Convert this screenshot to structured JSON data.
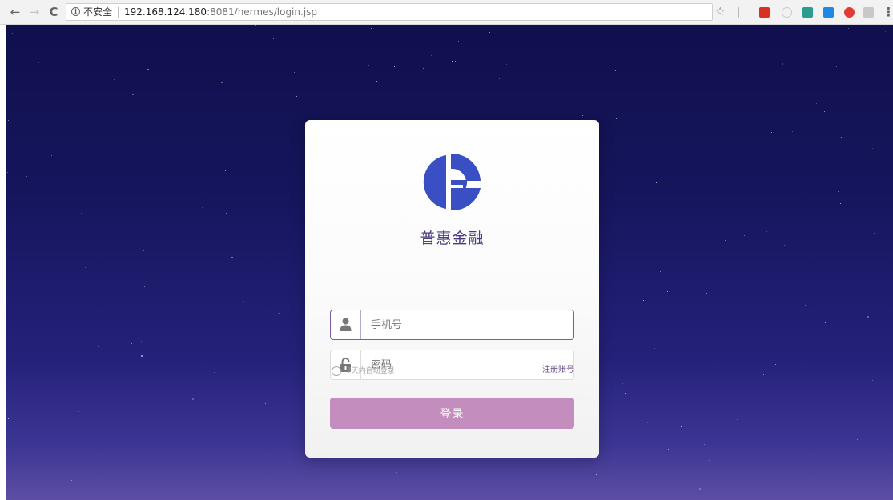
{
  "browser": {
    "url_security_label": "不安全",
    "url_host": "192.168.124.180",
    "url_rest": ":8081/hermes/login.jsp",
    "back_icon": "←",
    "forward_icon": "→",
    "reload_icon": "C",
    "info_icon": "i",
    "bookmark_icon": "☆",
    "menu_icon": "⋮",
    "extensions": [
      {
        "name": "lightning-extension-icon",
        "color": "#b9b9b9"
      },
      {
        "name": "fe-extension-icon",
        "color": "#d93025"
      },
      {
        "name": "circle-extension-icon",
        "color": "#c8c8c8"
      },
      {
        "name": "dots-extension-icon",
        "color": "#2a9d8f"
      },
      {
        "name": "window-extension-icon",
        "color": "#1e88e5"
      },
      {
        "name": "block-extension-icon",
        "color": "#e53935"
      },
      {
        "name": "grey-extension-icon",
        "color": "#c8c8c8"
      }
    ]
  },
  "login": {
    "brand_name": "普惠金融",
    "phone_placeholder": "手机号",
    "password_placeholder": "密码",
    "remember_label": "7天内自动登录",
    "register_link": "注册账号",
    "login_button": "登录"
  },
  "colors": {
    "brand": "#3b4fc4",
    "accent": "#c38dbd",
    "link": "#6b4f92"
  }
}
